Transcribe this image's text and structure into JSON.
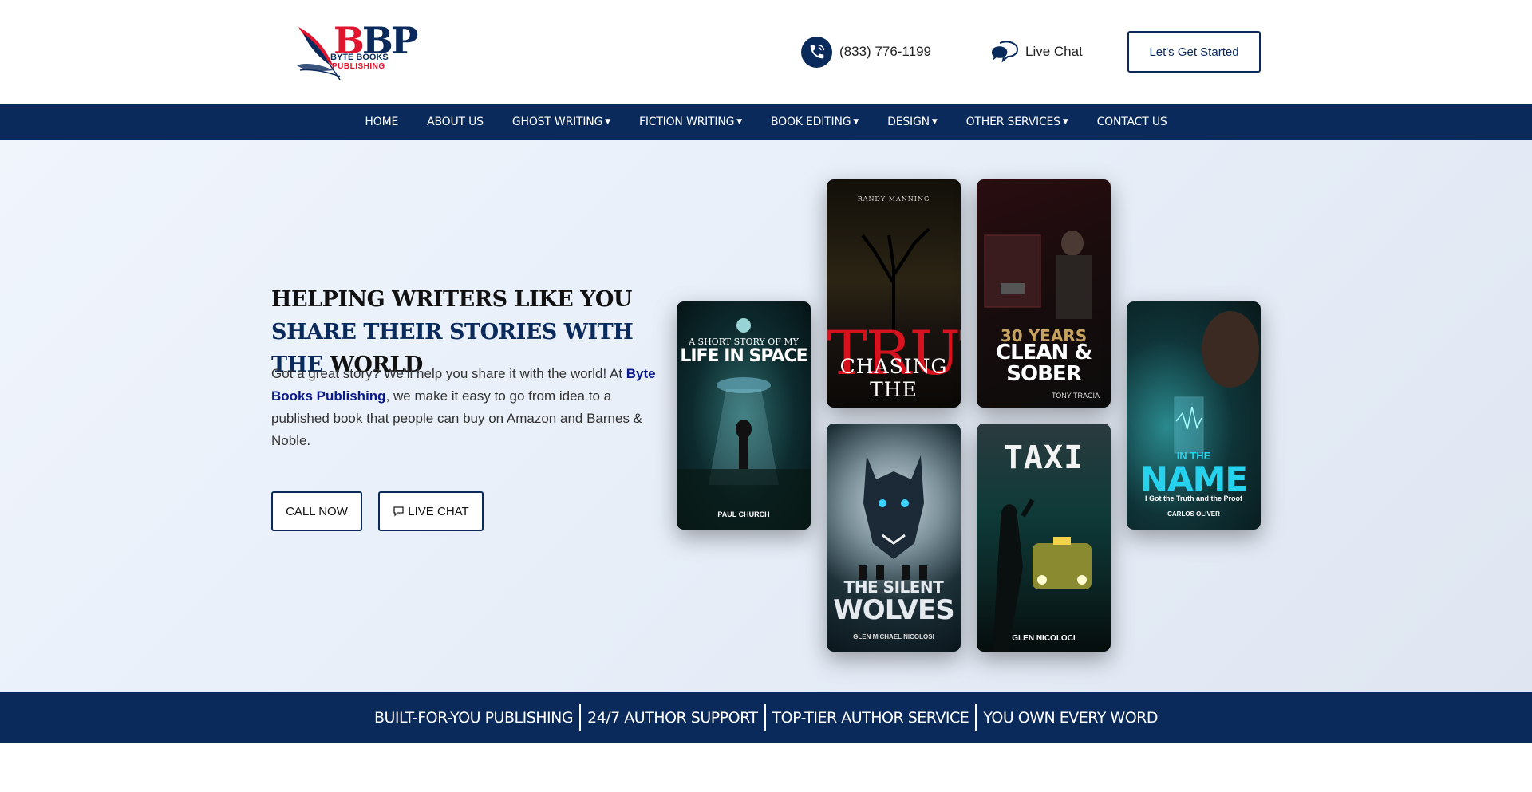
{
  "header": {
    "logo": {
      "initials_1": "B",
      "initials_2": "B",
      "initials_3": "P",
      "line1": "BYTE BOOKS",
      "line2": "PUBLISHING"
    },
    "phone": "(833) 776-1199",
    "live_chat": "Live Chat",
    "cta_label": "Let's Get Started"
  },
  "nav": {
    "items": [
      {
        "label": "HOME",
        "dropdown": false
      },
      {
        "label": "ABOUT US",
        "dropdown": false
      },
      {
        "label": "GHOST WRITING",
        "dropdown": true
      },
      {
        "label": "FICTION WRITING",
        "dropdown": true
      },
      {
        "label": "BOOK EDITING",
        "dropdown": true
      },
      {
        "label": "DESIGN",
        "dropdown": true
      },
      {
        "label": "OTHER SERVICES",
        "dropdown": true
      },
      {
        "label": "CONTACT US",
        "dropdown": false
      }
    ],
    "chevron_glyph": "❯"
  },
  "hero": {
    "title_part1": "HELPING WRITERS LIKE YOU ",
    "title_accent": "SHARE THEIR STORIES WITH THE",
    "title_part2": " WORLD",
    "para_before": "Got a great story? We’ll help you share it with the world! At ",
    "para_brand": "Byte Books Publishing",
    "para_after": ", we make it easy to go from idea to a published book that people can buy on Amazon and Barnes & Noble.",
    "call_now": "CALL NOW",
    "live_chat": "LIVE CHAT"
  },
  "books": {
    "space": {
      "line1": "A SHORT STORY OF MY",
      "line2": "LIFE IN SPACE",
      "author": "PAUL CHURCH"
    },
    "truth": {
      "author": "RANDY MANNING",
      "big": "TRUTH",
      "line": "CHASING THE"
    },
    "sober": {
      "line1": "30 YEARS",
      "line2": "CLEAN &",
      "line3": "SOBER",
      "author": "TONY TRACIA"
    },
    "name": {
      "line1": "IN THE",
      "line2": "NAME",
      "subtitle": "I Got the Truth and the Proof",
      "author": "CARLOS OLIVER"
    },
    "wolves": {
      "line1": "THE SILENT",
      "line2": "WOLVES",
      "author": "GLEN MICHAEL NICOLOSI"
    },
    "taxi": {
      "title": "TAXI",
      "author": "GLEN NICOLOCI"
    }
  },
  "band": {
    "items": [
      "BUILT-FOR-YOU PUBLISHING",
      "24/7 AUTHOR SUPPORT",
      "TOP-TIER AUTHOR SERVICE",
      "YOU OWN EVERY WORD"
    ]
  },
  "colors": {
    "brand_navy": "#0a2a5c",
    "brand_red": "#e0142d",
    "truth_red": "#d5121e",
    "name_cyan": "#27d2ef"
  }
}
